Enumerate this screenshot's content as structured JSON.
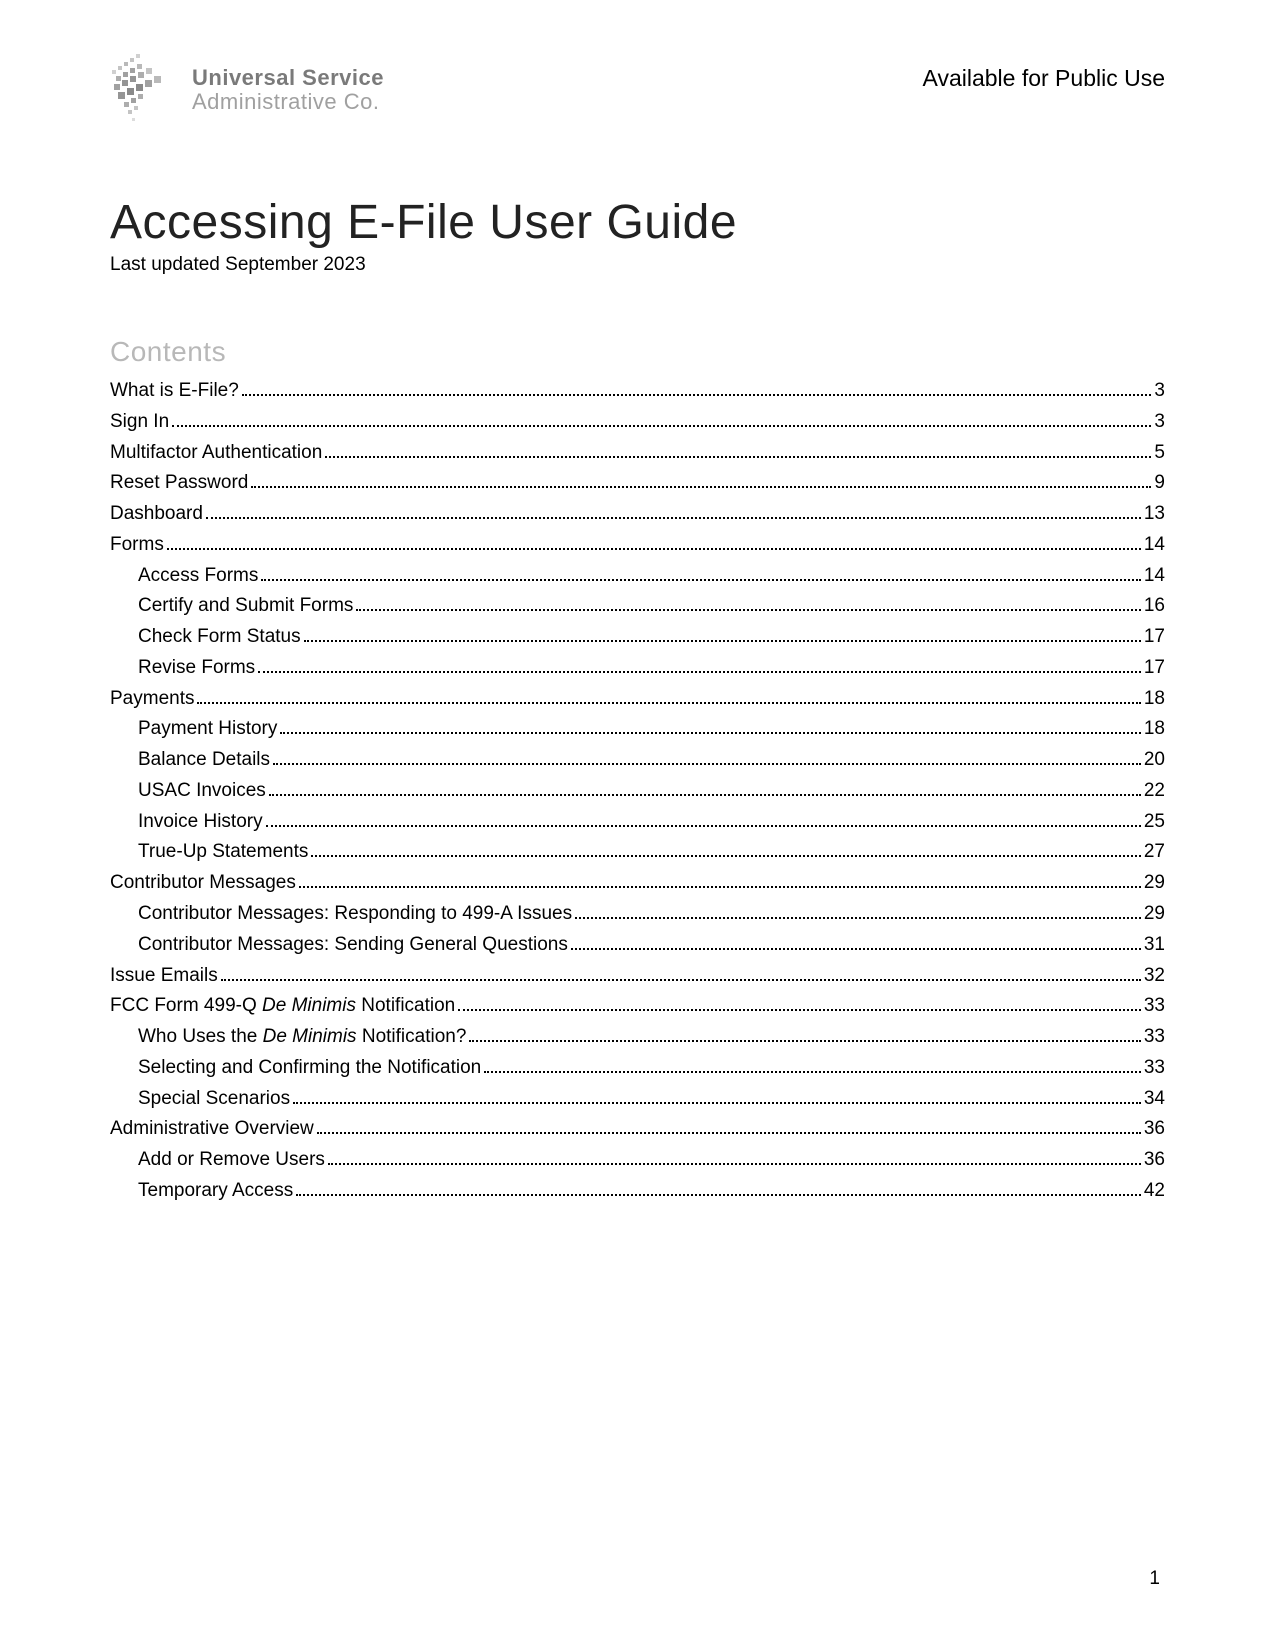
{
  "header": {
    "logo_line1": "Universal Service",
    "logo_line2": "Administrative Co.",
    "public_use": "Available for Public Use"
  },
  "title": "Accessing E-File User Guide",
  "last_updated": "Last updated September 2023",
  "contents_heading": "Contents",
  "toc": [
    {
      "level": 1,
      "label": "What is E-File?",
      "page": "3"
    },
    {
      "level": 1,
      "label": "Sign In",
      "page": "3"
    },
    {
      "level": 1,
      "label": "Multifactor Authentication",
      "page": "5"
    },
    {
      "level": 1,
      "label": "Reset Password",
      "page": "9"
    },
    {
      "level": 1,
      "label": "Dashboard",
      "page": "13"
    },
    {
      "level": 1,
      "label": "Forms",
      "page": "14"
    },
    {
      "level": 2,
      "label": "Access Forms",
      "page": "14"
    },
    {
      "level": 2,
      "label": "Certify and Submit Forms",
      "page": "16"
    },
    {
      "level": 2,
      "label": "Check Form Status",
      "page": "17"
    },
    {
      "level": 2,
      "label": "Revise Forms",
      "page": "17"
    },
    {
      "level": 1,
      "label": "Payments",
      "page": "18"
    },
    {
      "level": 2,
      "label": "Payment History",
      "page": "18"
    },
    {
      "level": 2,
      "label": "Balance Details",
      "page": "20"
    },
    {
      "level": 2,
      "label": "USAC Invoices",
      "page": "22"
    },
    {
      "level": 2,
      "label": "Invoice History",
      "page": "25"
    },
    {
      "level": 2,
      "label": "True-Up Statements",
      "page": "27"
    },
    {
      "level": 1,
      "label": "Contributor Messages",
      "page": "29"
    },
    {
      "level": 2,
      "label": "Contributor Messages: Responding to 499-A Issues",
      "page": "29"
    },
    {
      "level": 2,
      "label": "Contributor Messages: Sending General Questions",
      "page": "31"
    },
    {
      "level": 1,
      "label": "Issue Emails",
      "page": "32"
    },
    {
      "level": 1,
      "label_html": "FCC Form 499-Q <span class=\"italic\">De Minimis</span> Notification",
      "page": "33"
    },
    {
      "level": 2,
      "label_html": "Who Uses the <span class=\"italic\">De Minimis</span> Notification?",
      "page": "33"
    },
    {
      "level": 2,
      "label": "Selecting and Confirming the Notification",
      "page": "33"
    },
    {
      "level": 2,
      "label": "Special Scenarios",
      "page": "34"
    },
    {
      "level": 1,
      "label": "Administrative Overview",
      "page": "36"
    },
    {
      "level": 2,
      "label": "Add or Remove Users",
      "page": "36"
    },
    {
      "level": 2,
      "label": "Temporary Access",
      "page": "42"
    }
  ],
  "page_number": "1"
}
